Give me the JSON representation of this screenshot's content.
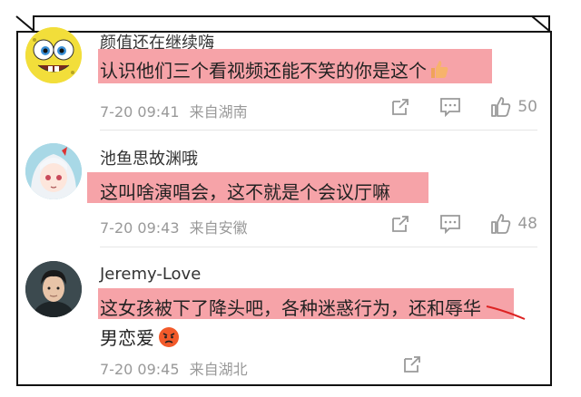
{
  "comments": [
    {
      "username": "颜值还在继续嗨",
      "text_line1": "认识他们三个看视频还能不笑的你是这个",
      "text_line2": "",
      "time": "7-20 09:41",
      "location": "来自湖南",
      "likes": "50",
      "emoji": "thumbs-up"
    },
    {
      "username": "池鱼思故渊哦",
      "text_line1": "这叫啥演唱会，这不就是个会议厅嘛",
      "text_line2": "",
      "time": "7-20 09:43",
      "location": "来自安徽",
      "likes": "48",
      "emoji": ""
    },
    {
      "username": "Jeremy-Love",
      "text_line1": "这女孩被下了降头吧，各种迷惑行为，还和辱华",
      "text_line2": "男恋爱",
      "time": "7-20 09:45",
      "location": "来自湖北",
      "likes": "",
      "emoji": "angry-face"
    }
  ],
  "colors": {
    "highlight": "#f6a3a8",
    "meta_text": "#999999",
    "frame": "#111111"
  }
}
